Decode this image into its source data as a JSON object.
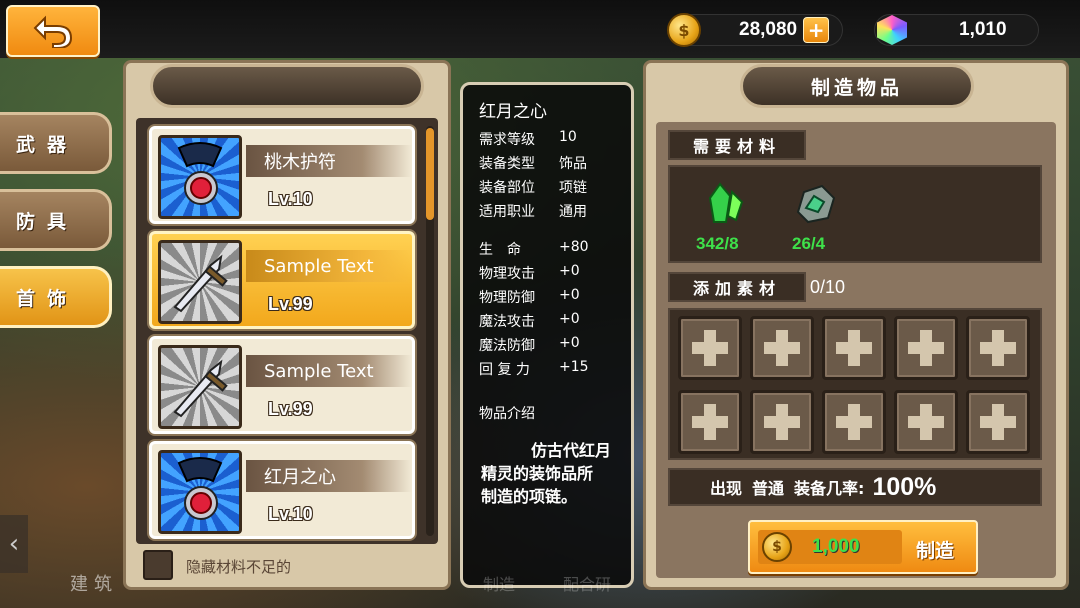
{
  "topbar": {
    "gold": "28,080",
    "gold_plus": "+",
    "gems": "1,010"
  },
  "categories": [
    {
      "label": "武器",
      "active": false
    },
    {
      "label": "防具",
      "active": false
    },
    {
      "label": "首饰",
      "active": true
    }
  ],
  "item_list": {
    "items": [
      {
        "name": "桃木护符",
        "level": "Lv.10",
        "icon": "amulet-icon",
        "selected": false
      },
      {
        "name": "Sample Text",
        "level": "Lv.99",
        "icon": "sword-icon",
        "selected": true
      },
      {
        "name": "Sample Text",
        "level": "Lv.99",
        "icon": "sword-icon",
        "selected": false
      },
      {
        "name": "红月之心",
        "level": "Lv.10",
        "icon": "amulet-icon",
        "selected": false
      }
    ],
    "hide_insufficient_label": "隐藏材料不足的"
  },
  "info": {
    "title": "红月之心",
    "rows": [
      {
        "k": "需求等级",
        "v": "10"
      },
      {
        "k": "装备类型",
        "v": "饰品"
      },
      {
        "k": "装备部位",
        "v": "项链"
      },
      {
        "k": "适用职业",
        "v": "通用"
      }
    ],
    "stats": [
      {
        "k": "生　命",
        "v": "+80"
      },
      {
        "k": "物理攻击",
        "v": "+0"
      },
      {
        "k": "物理防御",
        "v": "+0"
      },
      {
        "k": "魔法攻击",
        "v": "+0"
      },
      {
        "k": "魔法防御",
        "v": "+0"
      },
      {
        "k": "回 复 力",
        "v": "+15"
      }
    ],
    "desc_label": "物品介绍",
    "desc_line1": "仿古代红月",
    "desc_line2": "精灵的装饰品所",
    "desc_line3": "制造的项链。"
  },
  "craft": {
    "title": "制造物品",
    "materials_label": "需要材料",
    "materials": [
      {
        "icon": "green-crystal-icon",
        "count": "342/8"
      },
      {
        "icon": "ore-icon",
        "count": "26/4"
      }
    ],
    "add_label": "添加素材",
    "add_count": "0/10",
    "chance_prefix": "出现",
    "chance_quality": "普通",
    "chance_label": "装备几率:",
    "chance_value": "100%",
    "cost": "1,000",
    "craft_button": "制造"
  },
  "background_text": {
    "build": "建筑",
    "make": "制造",
    "config": "配合研"
  }
}
